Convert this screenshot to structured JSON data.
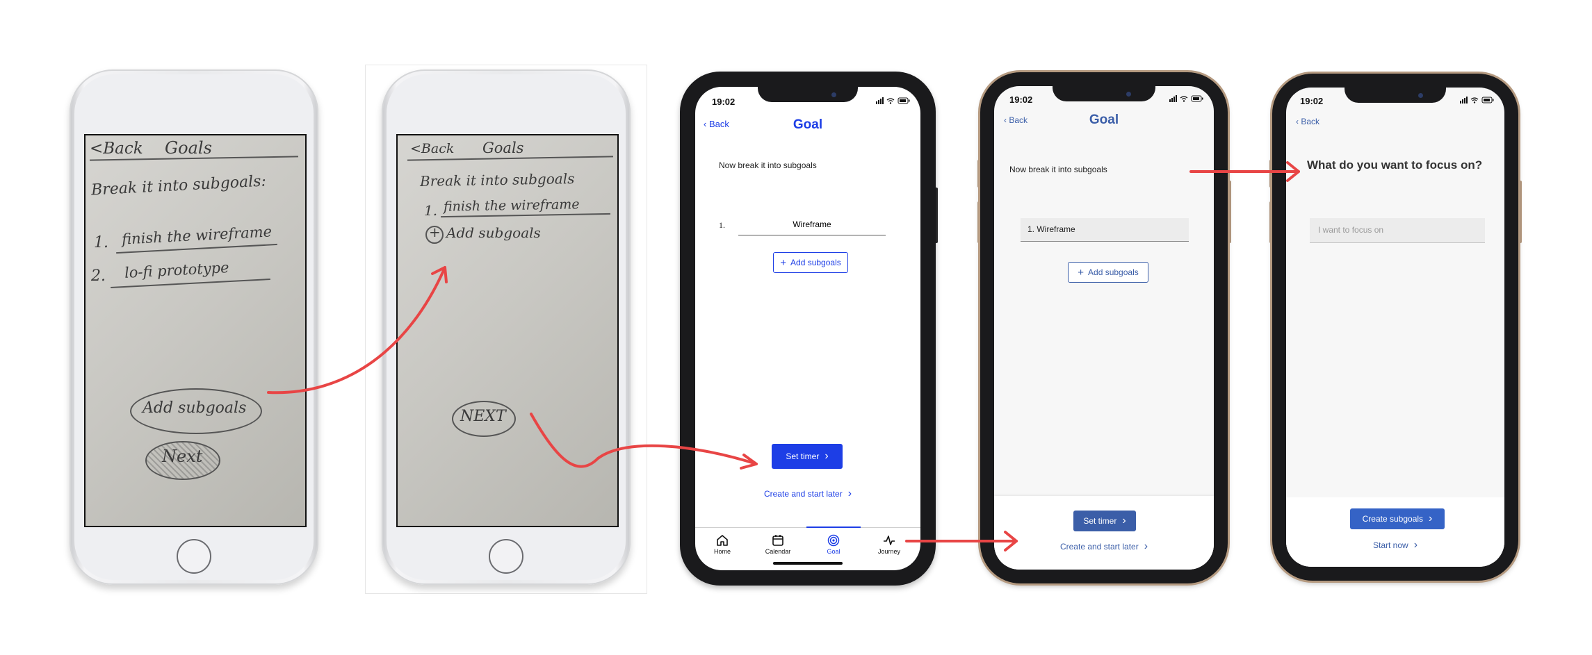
{
  "colors": {
    "arrow": "#e84545",
    "accent_blue": "#1d3ee6",
    "muted_blue": "#3b5ea8",
    "solid_button_hifi": "#3563c6"
  },
  "sketch1": {
    "back": "<Back",
    "title": "Goals",
    "heading": "Break it into subgoals:",
    "items": [
      "1.",
      "finish the wireframe",
      "2.",
      "lo-fi prototype"
    ],
    "add_button": "Add subgoals",
    "next_button": "Next"
  },
  "sketch2": {
    "back": "<Back",
    "title": "Goals",
    "heading": "Break it into subgoals",
    "item_num": "1.",
    "item_text": "finish the wireframe",
    "add_row": "Add subgoals",
    "next_button": "NEXT"
  },
  "midfi": {
    "time": "19:02",
    "back": "Back",
    "title": "Goal",
    "instruction": "Now break it into subgoals",
    "subgoal_num": "1.",
    "subgoal_value": "Wireframe",
    "add_button": "Add subgoals",
    "set_timer": "Set timer",
    "create_later": "Create and start later",
    "tabs": [
      "Home",
      "Calendar",
      "Goal",
      "Journey"
    ],
    "active_tab": "Goal"
  },
  "hifi1": {
    "time": "19:02",
    "back": "Back",
    "title": "Goal",
    "instruction": "Now break it into subgoals",
    "subgoal_value": "1. Wireframe",
    "add_button": "Add subgoals",
    "set_timer": "Set timer",
    "create_later": "Create and start later"
  },
  "hifi2": {
    "time": "19:02",
    "back": "Back",
    "question": "What do you want to focus on?",
    "focus_placeholder": "I want to focus on",
    "create_subgoals": "Create subgoals",
    "start_now": "Start now"
  },
  "icons": [
    "chevron-left-icon",
    "chevron-right-icon",
    "plus-icon",
    "home-icon",
    "calendar-icon",
    "target-icon",
    "pulse-icon",
    "signal-icon",
    "wifi-icon",
    "battery-icon"
  ]
}
